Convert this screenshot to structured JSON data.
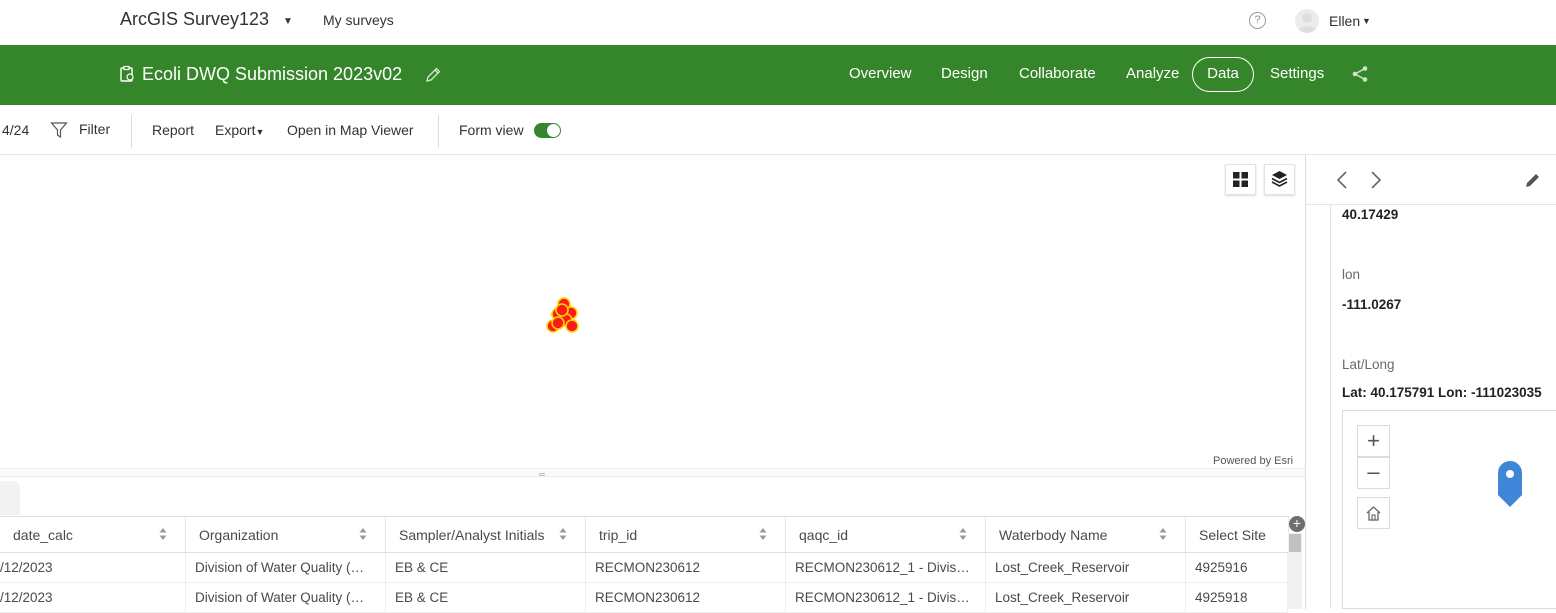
{
  "topbar": {
    "app_title": "ArcGIS Survey123",
    "my_surveys": "My surveys",
    "help_icon": "question-circle-icon",
    "user_name": "Ellen"
  },
  "survey": {
    "title": "Ecoli DWQ Submission 2023v02",
    "nav": {
      "overview": "Overview",
      "design": "Design",
      "collaborate": "Collaborate",
      "analyze": "Analyze",
      "data": "Data",
      "settings": "Settings"
    },
    "active_tab": "Data",
    "brand_color": "#35862a"
  },
  "toolbar": {
    "record_count": "4/24",
    "filter": "Filter",
    "report": "Report",
    "export": "Export",
    "open_map_viewer": "Open in Map Viewer",
    "form_view": "Form view",
    "form_view_on": true
  },
  "map": {
    "attribution": "Powered by Esri",
    "marker_color": "#ff0000",
    "marker_outline": "#ffd400"
  },
  "table": {
    "columns": [
      "date_calc",
      "Organization",
      "Sampler/Analyst Initials",
      "trip_id",
      "qaqc_id",
      "Waterbody Name",
      "Select Site"
    ],
    "rows": [
      [
        "/12/2023",
        "Division of Water Quality (…",
        "EB & CE",
        "RECMON230612",
        "RECMON230612_1 - Divis…",
        "Lost_Creek_Reservoir",
        "4925916"
      ],
      [
        "/12/2023",
        "Division of Water Quality (…",
        "EB & CE",
        "RECMON230612",
        "RECMON230612_1 - Divis…",
        "Lost_Creek_Reservoir",
        "4925918"
      ]
    ]
  },
  "panel": {
    "lat_value": "40.17429",
    "lon_label": "lon",
    "lon_value": "-111.0267",
    "latlong_label": "Lat/Long",
    "latlong_value": "Lat: 40.175791 Lon: -111023035"
  }
}
